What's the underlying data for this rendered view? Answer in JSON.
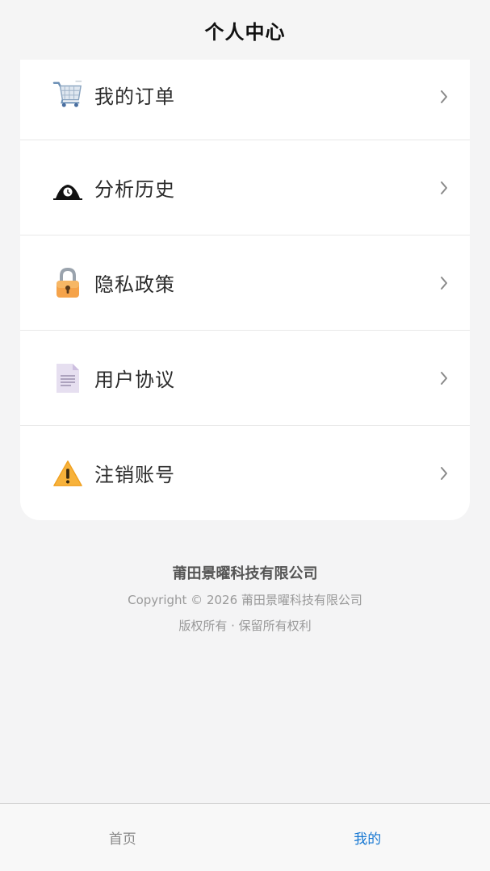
{
  "header": {
    "title": "个人中心"
  },
  "menu": [
    {
      "label": "我的订单",
      "icon": "shopping-cart-icon"
    },
    {
      "label": "分析历史",
      "icon": "history-icon"
    },
    {
      "label": "隐私政策",
      "icon": "lock-icon"
    },
    {
      "label": "用户协议",
      "icon": "document-icon"
    },
    {
      "label": "注销账号",
      "icon": "warning-icon"
    }
  ],
  "footer": {
    "company": "莆田景曜科技有限公司",
    "copyright": "Copyright © 2026 莆田景曜科技有限公司",
    "rights": "版权所有 · 保留所有权利"
  },
  "tabbar": {
    "home": "首页",
    "mine": "我的",
    "active_color": "#1677d2"
  }
}
